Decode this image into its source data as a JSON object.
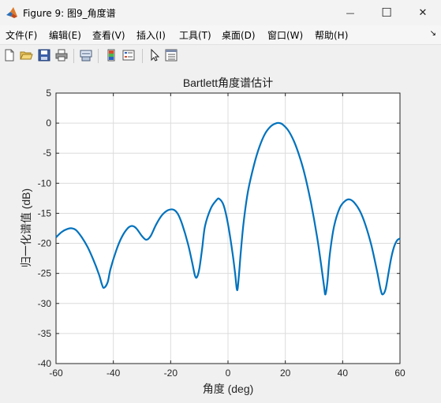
{
  "window": {
    "title": "Figure 9: 图9_角度谱",
    "minimize_glyph": "—",
    "maximize_glyph": "☐",
    "close_glyph": "✕"
  },
  "menu": {
    "items": [
      "文件(F)",
      "编辑(E)",
      "查看(V)",
      "插入(I)",
      "工具(T)",
      "桌面(D)",
      "窗口(W)",
      "帮助(H)"
    ],
    "overflow_glyph": "↘"
  },
  "toolbar": {
    "icons": [
      "new-figure-icon",
      "open-file-icon",
      "save-icon",
      "print-icon",
      "link-plot-icon",
      "colorbar-icon",
      "legend-icon",
      "edit-plot-arrow-icon",
      "property-inspector-icon"
    ]
  },
  "colors": {
    "line": "#0072BD",
    "grid": "#dcdcdc",
    "axes": "#262626"
  },
  "chart_data": {
    "type": "line",
    "title": "Bartlett角度谱估计",
    "xlabel": "角度 (deg)",
    "ylabel": "归一化谱值 (dB)",
    "xlim": [
      -60,
      60
    ],
    "ylim": [
      -40,
      5
    ],
    "xticks": [
      -60,
      -40,
      -20,
      0,
      20,
      40,
      60
    ],
    "yticks": [
      5,
      0,
      -5,
      -10,
      -15,
      -20,
      -25,
      -30,
      -35,
      -40
    ],
    "grid": true,
    "series": [
      {
        "x": [
          -60,
          -58,
          -56,
          -54.5,
          -53,
          -51,
          -49,
          -47,
          -45,
          -44,
          -43.3,
          -42,
          -41,
          -39,
          -37,
          -35,
          -33.5,
          -32,
          -30,
          -28.5,
          -27,
          -25,
          -23,
          -21,
          -19,
          -17.5,
          -16,
          -14,
          -12.5,
          -11.5,
          -10.8,
          -10,
          -9,
          -8,
          -6,
          -4,
          -3,
          -1.5,
          0,
          1.5,
          2.5,
          3.2,
          3.8,
          4.5,
          5.5,
          7,
          9,
          11,
          13,
          15,
          17,
          18,
          19,
          21,
          23,
          25,
          27,
          29,
          31,
          32.5,
          33.5,
          34,
          34.7,
          35.5,
          37,
          39,
          41,
          42.5,
          44,
          46,
          48,
          50,
          52,
          53.3,
          54,
          55,
          56,
          57,
          58,
          59,
          60
        ],
        "y": [
          -19,
          -18.1,
          -17.6,
          -17.5,
          -17.8,
          -19,
          -20.6,
          -22.7,
          -25.2,
          -26.8,
          -27.4,
          -26.5,
          -24.3,
          -21.2,
          -18.9,
          -17.5,
          -17.1,
          -17.5,
          -18.8,
          -19.4,
          -18.8,
          -16.8,
          -15.3,
          -14.5,
          -14.4,
          -15.1,
          -16.8,
          -20,
          -23.2,
          -25.4,
          -25.6,
          -24.2,
          -20.8,
          -17.1,
          -14.2,
          -12.8,
          -12.6,
          -13.7,
          -16.8,
          -21.3,
          -25.1,
          -27.8,
          -25.4,
          -21.2,
          -16.3,
          -11.3,
          -7.1,
          -3.9,
          -1.7,
          -0.5,
          0,
          0,
          -0.2,
          -1.2,
          -3,
          -5.6,
          -9,
          -13.4,
          -18.7,
          -23.6,
          -27.1,
          -28.5,
          -26.3,
          -21.9,
          -17.2,
          -14.1,
          -12.9,
          -12.7,
          -13.2,
          -14.6,
          -17,
          -20.3,
          -24.6,
          -27.8,
          -28.5,
          -27.6,
          -24.9,
          -22.3,
          -20.5,
          -19.5,
          -19.2
        ]
      }
    ]
  }
}
